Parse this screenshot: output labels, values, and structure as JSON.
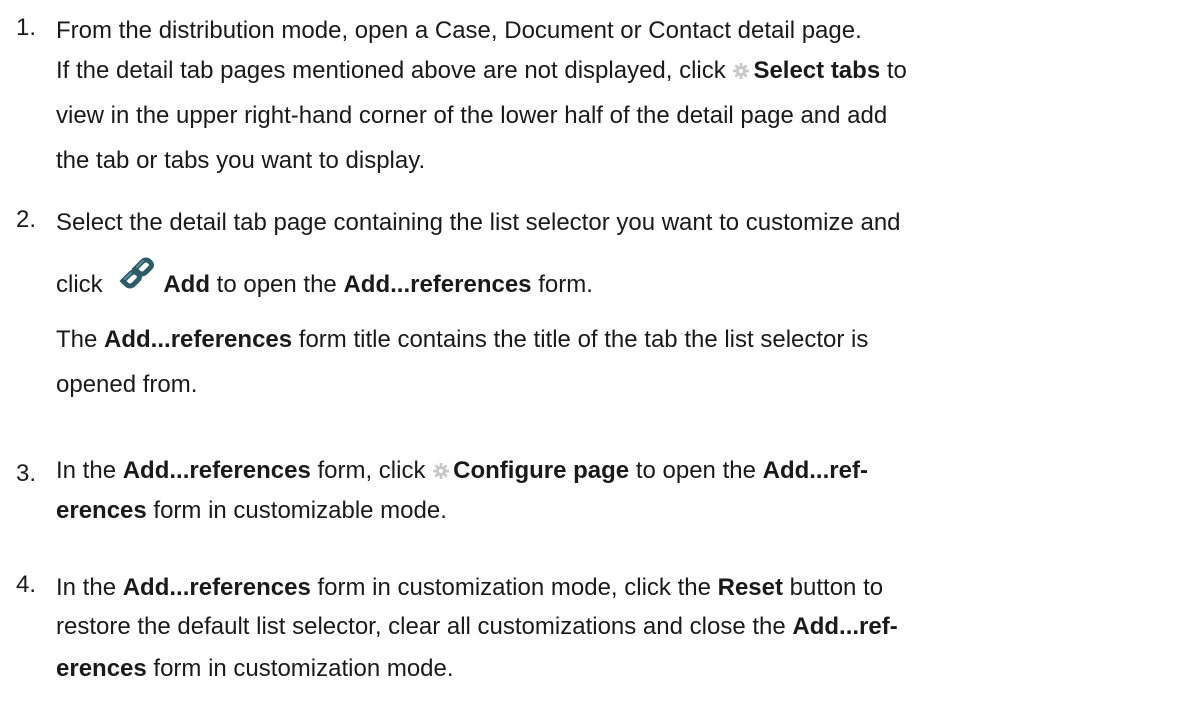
{
  "steps": [
    {
      "number": "1.",
      "lines": [
        [
          "From the distribution mode, open a Case, Document or Contact detail page."
        ],
        [
          "If the detail tab pages mentioned above are not displayed, click ",
          {
            "icon": "gear-icon"
          },
          {
            "b": "Select tabs"
          },
          " to"
        ],
        [
          "view in the upper right-hand corner of the lower half of the detail page and add"
        ],
        [
          "the tab or tabs you want to display."
        ]
      ]
    },
    {
      "number": "2.",
      "lines": [
        [
          "Select the detail tab page containing the list selector you want to customize and"
        ],
        [
          "click ",
          {
            "icon": "link-icon"
          },
          {
            "b": "Add"
          },
          " to open the ",
          {
            "b": "Add...references"
          },
          " form."
        ],
        [
          "The ",
          {
            "b": "Add...references"
          },
          " form title contains the title of the tab the list selector is"
        ],
        [
          "opened from."
        ]
      ]
    },
    {
      "number": "3.",
      "lines": [
        [
          "In the ",
          {
            "b": "Add...references"
          },
          " form, click ",
          {
            "icon": "gear-icon"
          },
          {
            "b": "Configure page"
          },
          " to open the ",
          {
            "b": "Add...ref-"
          }
        ],
        [
          {
            "b": "erences"
          },
          " form in customizable mode."
        ]
      ]
    },
    {
      "number": "4.",
      "lines": [
        [
          "In the ",
          {
            "b": "Add...references"
          },
          " form in customization mode, click the ",
          {
            "b": "Reset"
          },
          " button to"
        ],
        [
          "restore the default list selector, clear all customizations and close the ",
          {
            "b": "Add...ref-"
          }
        ],
        [
          {
            "b": "erences"
          },
          " form in customization mode."
        ]
      ]
    }
  ]
}
